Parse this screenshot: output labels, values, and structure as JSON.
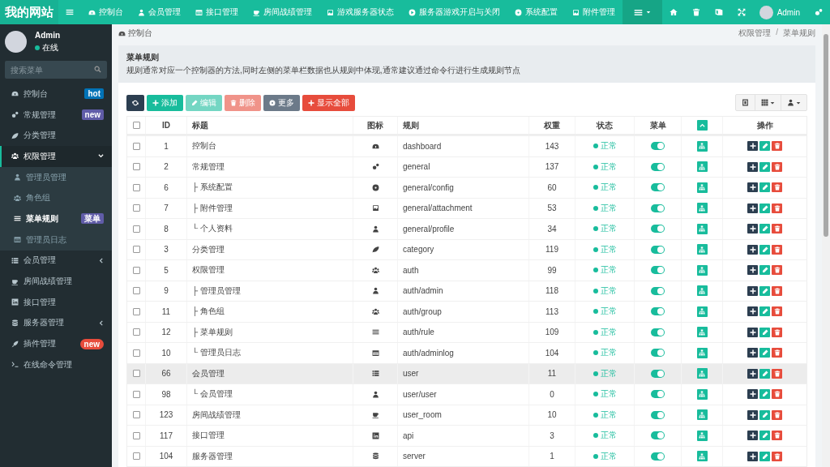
{
  "logo": {
    "text": "我的网站"
  },
  "top_nav": [
    {
      "label": "控制台"
    },
    {
      "label": "会员管理"
    },
    {
      "label": "接口管理"
    },
    {
      "label": "房间战绩管理"
    },
    {
      "label": "游戏服务器状态"
    },
    {
      "label": "服务器游戏开启与关闭"
    },
    {
      "label": "系统配置"
    },
    {
      "label": "附件管理"
    }
  ],
  "top_right": {
    "user_name": "Admin"
  },
  "user_panel": {
    "name": "Admin",
    "status": "在线",
    "online": true
  },
  "sidebar_search": {
    "placeholder": "搜索菜单"
  },
  "sidebar": [
    {
      "label": "控制台",
      "badge": {
        "text": "hot",
        "color": "#0073b7"
      },
      "selected": false
    },
    {
      "label": "常规管理",
      "badge": {
        "text": "new",
        "color": "#605ca8"
      },
      "selected": false
    },
    {
      "label": "分类管理",
      "selected": false
    },
    {
      "label": "权限管理",
      "selected": true,
      "expanded": true,
      "children": [
        {
          "label": "管理员管理",
          "selected": false
        },
        {
          "label": "角色组",
          "selected": false
        },
        {
          "label": "菜单规则",
          "selected": true,
          "badge": {
            "text": "菜单",
            "color": "#605ca8"
          }
        },
        {
          "label": "管理员日志",
          "selected": false
        }
      ]
    },
    {
      "label": "会员管理",
      "selected": false,
      "expanded": false
    },
    {
      "label": "房间战绩管理",
      "selected": false
    },
    {
      "label": "接口管理",
      "selected": false
    },
    {
      "label": "服务器管理",
      "selected": false,
      "expanded": false
    },
    {
      "label": "插件管理",
      "badge": {
        "text": "new",
        "color": "#e74c3c"
      },
      "selected": false
    },
    {
      "label": "在线命令管理",
      "selected": false
    }
  ],
  "breadcrumb": {
    "home": "控制台",
    "separator": "/",
    "trail": [
      "权限管理",
      "菜单规则"
    ]
  },
  "info_panel": {
    "title": "菜单规则",
    "description": "规则通常对应一个控制器的方法,同时左侧的菜单栏数据也从规则中体现,通常建议通过命令行进行生成规则节点"
  },
  "toolbar": [
    {
      "kind": "refresh",
      "disabled": false
    },
    {
      "kind": "add",
      "label": "添加",
      "disabled": false
    },
    {
      "kind": "edit",
      "label": "编辑",
      "disabled": true
    },
    {
      "kind": "delete",
      "label": "删除",
      "disabled": true
    },
    {
      "kind": "more",
      "label": "更多",
      "disabled": false
    },
    {
      "kind": "showall",
      "label": "显示全部",
      "disabled": false
    }
  ],
  "table": {
    "all_checked": false,
    "columns": [
      "ID",
      "标题",
      "图标",
      "规则",
      "权重",
      "状态",
      "菜单",
      "操作"
    ],
    "rows": [
      {
        "id": "1",
        "title": "控制台",
        "rule": "dashboard",
        "weight": "143",
        "status": "正常",
        "menu": true,
        "checked": false,
        "hovered": false
      },
      {
        "id": "2",
        "title": "常规管理",
        "rule": "general",
        "weight": "137",
        "status": "正常",
        "menu": true,
        "checked": false,
        "hovered": false
      },
      {
        "id": "6",
        "title": "├ 系统配置",
        "rule": "general/config",
        "weight": "60",
        "status": "正常",
        "menu": true,
        "checked": false,
        "hovered": false
      },
      {
        "id": "7",
        "title": "├ 附件管理",
        "rule": "general/attachment",
        "weight": "53",
        "status": "正常",
        "menu": true,
        "checked": false,
        "hovered": false
      },
      {
        "id": "8",
        "title": "└ 个人资料",
        "rule": "general/profile",
        "weight": "34",
        "status": "正常",
        "menu": true,
        "checked": false,
        "hovered": false
      },
      {
        "id": "3",
        "title": "分类管理",
        "rule": "category",
        "weight": "119",
        "status": "正常",
        "menu": true,
        "checked": false,
        "hovered": false
      },
      {
        "id": "5",
        "title": "权限管理",
        "rule": "auth",
        "weight": "99",
        "status": "正常",
        "menu": true,
        "checked": false,
        "hovered": false
      },
      {
        "id": "9",
        "title": "├ 管理员管理",
        "rule": "auth/admin",
        "weight": "118",
        "status": "正常",
        "menu": true,
        "checked": false,
        "hovered": false
      },
      {
        "id": "11",
        "title": "├ 角色组",
        "rule": "auth/group",
        "weight": "113",
        "status": "正常",
        "menu": true,
        "checked": false,
        "hovered": false
      },
      {
        "id": "12",
        "title": "├ 菜单规则",
        "rule": "auth/rule",
        "weight": "109",
        "status": "正常",
        "menu": true,
        "checked": false,
        "hovered": false
      },
      {
        "id": "10",
        "title": "└ 管理员日志",
        "rule": "auth/adminlog",
        "weight": "104",
        "status": "正常",
        "menu": true,
        "checked": false,
        "hovered": false
      },
      {
        "id": "66",
        "title": "会员管理",
        "rule": "user",
        "weight": "11",
        "status": "正常",
        "menu": true,
        "checked": false,
        "hovered": true
      },
      {
        "id": "98",
        "title": "└ 会员管理",
        "rule": "user/user",
        "weight": "0",
        "status": "正常",
        "menu": true,
        "checked": false,
        "hovered": false
      },
      {
        "id": "123",
        "title": "房间战绩管理",
        "rule": "user_room",
        "weight": "10",
        "status": "正常",
        "menu": true,
        "checked": false,
        "hovered": false
      },
      {
        "id": "117",
        "title": "接口管理",
        "rule": "api",
        "weight": "3",
        "status": "正常",
        "menu": true,
        "checked": false,
        "hovered": false
      },
      {
        "id": "104",
        "title": "服务器管理",
        "rule": "server",
        "weight": "1",
        "status": "正常",
        "menu": true,
        "checked": false,
        "hovered": false
      }
    ]
  }
}
